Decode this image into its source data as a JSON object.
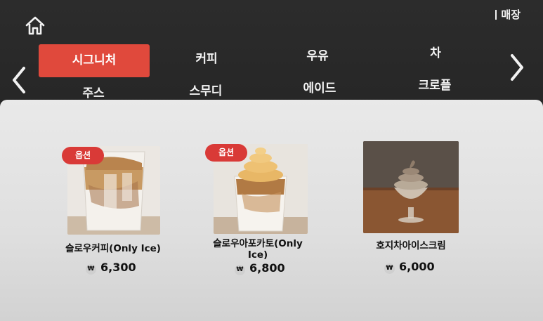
{
  "header": {
    "store_label": "매장"
  },
  "tabs": [
    {
      "label": "시그니처",
      "active": true
    },
    {
      "label": "커피"
    },
    {
      "label": "우유"
    },
    {
      "label": "차"
    },
    {
      "label": "주스"
    },
    {
      "label": "스무디"
    },
    {
      "label": "에이드"
    },
    {
      "label": "크로플"
    }
  ],
  "products": [
    {
      "name": "슬로우커피(Only Ice)",
      "price": "6,300",
      "badge": "옵션",
      "icon": "iced-latte-photo"
    },
    {
      "name": "슬로우아포카토(Only Ice)",
      "price": "6,800",
      "badge": "옵션",
      "icon": "affogato-photo"
    },
    {
      "name": "호지차아이스크림",
      "price": "6,000",
      "icon": "hojicha-icecream-photo"
    }
  ],
  "currency_symbol": "₩",
  "colors": {
    "accent": "#e0493c",
    "badge": "#d93a37",
    "header_bg": "#2a2a2a",
    "content_bg": "#e6e6e6"
  }
}
